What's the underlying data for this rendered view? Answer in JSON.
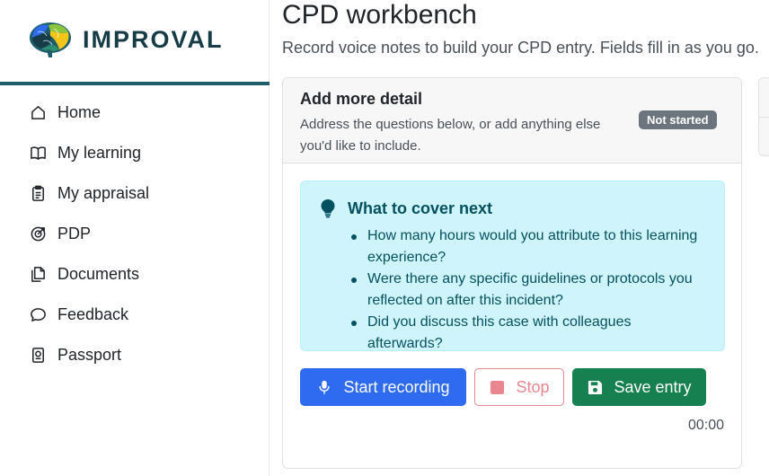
{
  "brand": {
    "name": "IMPROVAL",
    "logo_icon": "brain-logo-icon",
    "colors": {
      "primary": "#163c47",
      "rule": "#1c5f6b"
    }
  },
  "nav": {
    "items": [
      {
        "label": "Home",
        "icon": "home-icon"
      },
      {
        "label": "My learning",
        "icon": "book-icon"
      },
      {
        "label": "My appraisal",
        "icon": "clipboard-icon"
      },
      {
        "label": "PDP",
        "icon": "target-icon"
      },
      {
        "label": "Documents",
        "icon": "documents-icon"
      },
      {
        "label": "Feedback",
        "icon": "chat-bubble-icon"
      },
      {
        "label": "Passport",
        "icon": "passport-icon"
      }
    ]
  },
  "page": {
    "title": "CPD workbench",
    "subtitle": "Record voice notes to build your CPD entry. Fields fill in as you go."
  },
  "detail_card": {
    "title": "Add more detail",
    "description": "Address the questions below, or add anything else you'd like to include.",
    "status": "Not started",
    "tip": {
      "icon": "lightbulb-icon",
      "title": "What to cover next",
      "items": [
        "How many hours would you attribute to this learning experience?",
        "Were there any specific guidelines or protocols you reflected on after this incident?",
        "Did you discuss this case with colleagues afterwards?"
      ]
    },
    "actions": {
      "start_label": "Start recording",
      "stop_label": "Stop",
      "save_label": "Save entry"
    },
    "timer": "00:00"
  },
  "colors": {
    "primary_button": "#2f6bf0",
    "stop_button": "#ea868f",
    "save_button": "#168050",
    "tip_background": "#cff4fc",
    "status_badge": "#6c757d"
  }
}
